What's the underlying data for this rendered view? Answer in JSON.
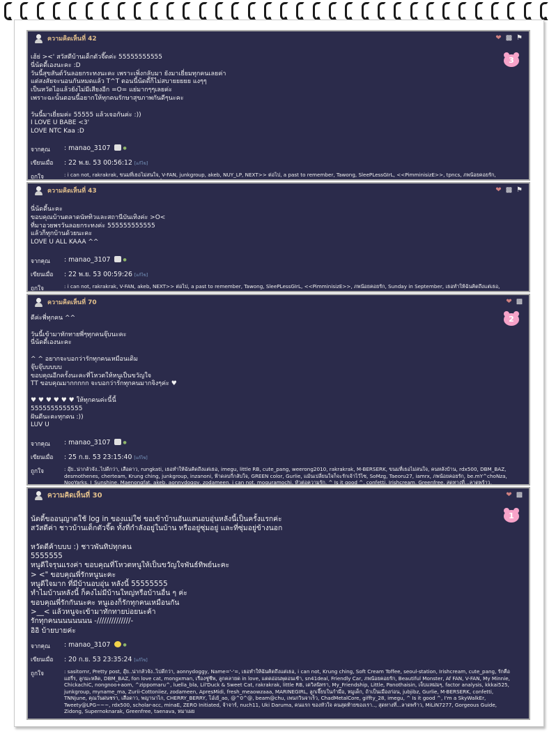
{
  "posts": [
    {
      "title": "ความคิดเห็นที่ 42",
      "badge": "3",
      "body": "เฮ้ย่ ><' สวัสดีบ้านเด็กตัวจี๊ดค่ะ 55555555555\nนี่น้ดดี้เองนะคะ :D\nวันนี้สุขสันต์วันลอยกระทงนะคะ เพราะเพิ่งกลับมา ยังมาเยี่ยมทุกคนเลยค่า\nแต่สงสัยจะนอนกันหมดแล้ว T^T ตอนนี้น้ดดี้ก็ไม่สบายยยยย แงๆๆ\nเป็นหวัดไอแล้วยังไม่มีเสียงอีก =O= แย่มากๆๆเลยค่ะ\nเพราะฉะนั้นตอนนี้อยากให้ทุกคนรักษาสุขภาพกันดีๆนะคะ\n\nวันนี้มาเยี่ยมค่ะ 55555 แล้วเจอกันค่ะ :))\nI LOVE U BABE <3'\nLOVE NTC Kaa :D",
      "from_label": "จากคุณ",
      "author": ": manao_3107",
      "date_label": "เขียนเมื่อ",
      "date": ": 22 พ.ย. 53 00:56:12",
      "ip": "[แก้ไข]",
      "likes_label": "ถูกใจ",
      "likes": ": i can not, rakrakrak, ขนมที่เธอไม่สนใจ, V-FAN, junkgroup, akeb, NUY_LP, NEXT>> ต่อไป, a past to remember, Tawong, SleePLessGIrL, <<PimminisizE>>, tpncs, ภพน้อยคอยรัก, aon_biot, Sunday in September, เธอทำให้ฉันคิดถึงแต่เธอ, cute_pang, J_Sunshine, confetti, Fr_Gump, iamrx, lawanofrcg, Name='-'="
    },
    {
      "title": "ความคิดเห็นที่ 43",
      "badge": "",
      "body": "นี่น้ดดี้นะคะ\nขอบคุณบ้านตลาดนัททิวและสถานีบันเทิงค่ะ >O<\nที่มาอวยพรวันลอยกระทงค่ะ 555555555555\nแล้วก็ทุกบ้านด้วยนะคะ\nLOVE U ALL KAAA ^^",
      "from_label": "จากคุณ",
      "author": ": manao_3107",
      "date_label": "เขียนเมื่อ",
      "date": ": 22 พ.ย. 53 00:59:26",
      "ip": "[แก้ไข]",
      "likes_label": "ถูกใจ",
      "likes": ": i can not, rakrakrak, V-FAN, akeb, NEXT>> ต่อไป, a past to remember, Tawong, SleePLessGIrL, <<PimminisizE>>, ภพน้อยคอยรัก, Sunday in September, เธอทำให้ฉันคิดถึงแต่เธอ, cute_pang, lawanofrcg"
    },
    {
      "title": "ความคิดเห็นที่ 70",
      "badge": "2",
      "body": "ดีค่ะพี่ทุกคน ^^\n\nวันนี้เข้ามาทักทายพี่ๆทุกคนจุ๊บนะคะ\nนี่น้ดดี้เองนะคะ\n\n^ ^ อยากจะบอกว่ารักทุกคนเหมือนเดิม\nจุ๊บจุ๊บบบบบ\nขอบคุณอีกครั้งนะคะที่โหวตให้หนูเป็นขวัญใจ\nTT ขอบคุณมากกกกก จะบอกว่ารักทุกคนมากจิงๆค่ะ ♥\n\n♥ ♥ ♥ ♥ ♥ ♥  ให้ทุกคนค่ะนี้นี้\n5555555555555\nฝันดีนะคะทุกคน :))\nLUV U",
      "from_label": "จากคุณ",
      "author": ": manao_3107",
      "date_label": "เขียนเมื่อ",
      "date": ": 25 ก.ย. 53 23:15:40",
      "ip": "[แก้ไข]",
      "likes_label": "ถูกใจ",
      "likes": ": อุ๊ย..น่ากลัวจัง..ไปดีกว่า, เสือดาว, rungkati, เธอทำให้ฉันคิดถึงแต่เธอ, imegu, little RB, cute_pang, weerong2010, rakrakrak, M-BERSERK, ขนมที่เธอไม่สนใจ, คนหลังบ้าน, rdx500, DBM_BAZ, desmothenes, cherteam, Krung ching, junkgroup, inzanoni, ฟ้าดลบกี่กลับใจ, GREEN color, Gurlie, แม้นเปลี่ยนใจก็จะรักเจ้าไว้ไซ, SoMzg, Taeoru27, iamrx, ภพน้อยคอยรัก, be.mY^choNza, NooYarks, J_Sunshine, Maenongfat, akeb, aonnydoggy, zodameen, i can not, moguramochi, หัวต่อความรัก, ^ Is it good ^, confetti, Irishcream, Greenfree, สุดทางที่...ลาดพร้าว, Lil'Duck & Sweet Cat, เคยเป็นไปได้"
    },
    {
      "title": "ความคิดเห็นที่ 30",
      "badge": "1",
      "body": "น้ดดี้ขออนุญาตใช้ log in ของแม่ใช่ ขอเข้าบ้านอันแสนอบอุ่นหลังนี้เป็นครั้งแรกค่ะ\nสวัสดีค่า ชาวบ้านเด็กตัวจี๊ด ทั้งที่กำลังอยู่ในบ้าน หรืออยู่ซุ่มอยู่ และที่ซุ่มอยู่ข้างนอก\n\nหวัดดีค้าบบบ :) ชาวพันทิปทุกคน\n5555555\nหนูดีใจรุนแรงค่า ขอบคุณที่โหวตหนูให้เป็นขวัญใจพันธ์ทิพย์นะคะ\n> <\" ขอบคุณพี่รักหนูนะคะ\nหนูดีใจมาก ที่มีบ้านอบอุ่น หลังนี้ 55555555\nทำไมบ้านหลังนี้ ก็คงไม่มีบ้านใหญ่หรือบ้านอื่น ๆ ค่ะ\nขอบคุณพี่รักกันนะคะ หนูเองก็รักทุกคนเหมือนกัน\n>__< แล้วหนูจะเข้ามาทักทายบ่อยนะค้า\nรักทุกคนนนนนนนน -//////////////-\nอิอิ บ้ายบายค่ะ",
      "from_label": "จากคุณ",
      "author": ": manao_3107",
      "date_label": "เขียนเมื่อ",
      "date": ": 20 ก.ย. 53 23:35:24",
      "ip": "[แก้ไข]",
      "likes_label": "ถูกใจ",
      "likes": ": sasitornr, Pretty post, อุ๊ย..น่ากลัวจัง..ไปดีกว่า, aonnydoggy, Name='-'=, เธอทำให้ฉันคิดถึงแต่เธอ, i can not, Krung ching, Soft Cream Toffee, seoul-station, Irishcream, cute_pang, รักคือแฮรี่ร, ลูกมะหลิด, DBM_BAZ, fon love cat, mongxman, เรืองชู่ชีพ, ลูกคลายด in love, แดดอ่อนพุดอนเช้า, sn41deal, Friendly Car, ภพน้อยคอยรัก, Beautiful Monster, Af FAN, V-FAN, My Minnie, ChickachiC, nongnoo+aom, ^zippomaru^, luella_bla, Lil'Duck & Sweet Cat, rakrakrak, little RB, เดวิลนิทรา, My_Friendship, Little, Panothaisin, เจ็บแหม่มๆ, factor analysis, kkkai525, junkgroup, myname_ma, Zurii-Cottoniiez, zodameen, ApresMidi, fresh_meaowzaaa, MARINEGIRL, ลูกเจี๊ยบในกำมือ, หมูเด็ก, ถ้าเป็นเมืองก่อน, jubjibz, Gurlie, M-BERSERK, confetti, TNNjune, คุณวันฝนชรา, เสือดาว, พญานาไก, CHERRY_BERRY, โอ๋เย้_ao, @^0^@, beam@chu, เพนกวินจาเร็ว, ChadMetalCore, giffty_28, imegu, ^ Is it good ^, I'm a SkyWalkEr, Tweety@LPG~~~, rdx500, scholar-acc, minaE, ZERO Initiated, จ้าจาร์, nuch11, Uki Daruma, คนแรก ของหัวใจ คนสุดท้ายของเรา.., สุดทางที่...ลาดพร้าว, MiLiN7277, Gorgeous Guide, Zidong, Supernoknarak, Greenfree, taenava, หมาเผย"
    }
  ]
}
